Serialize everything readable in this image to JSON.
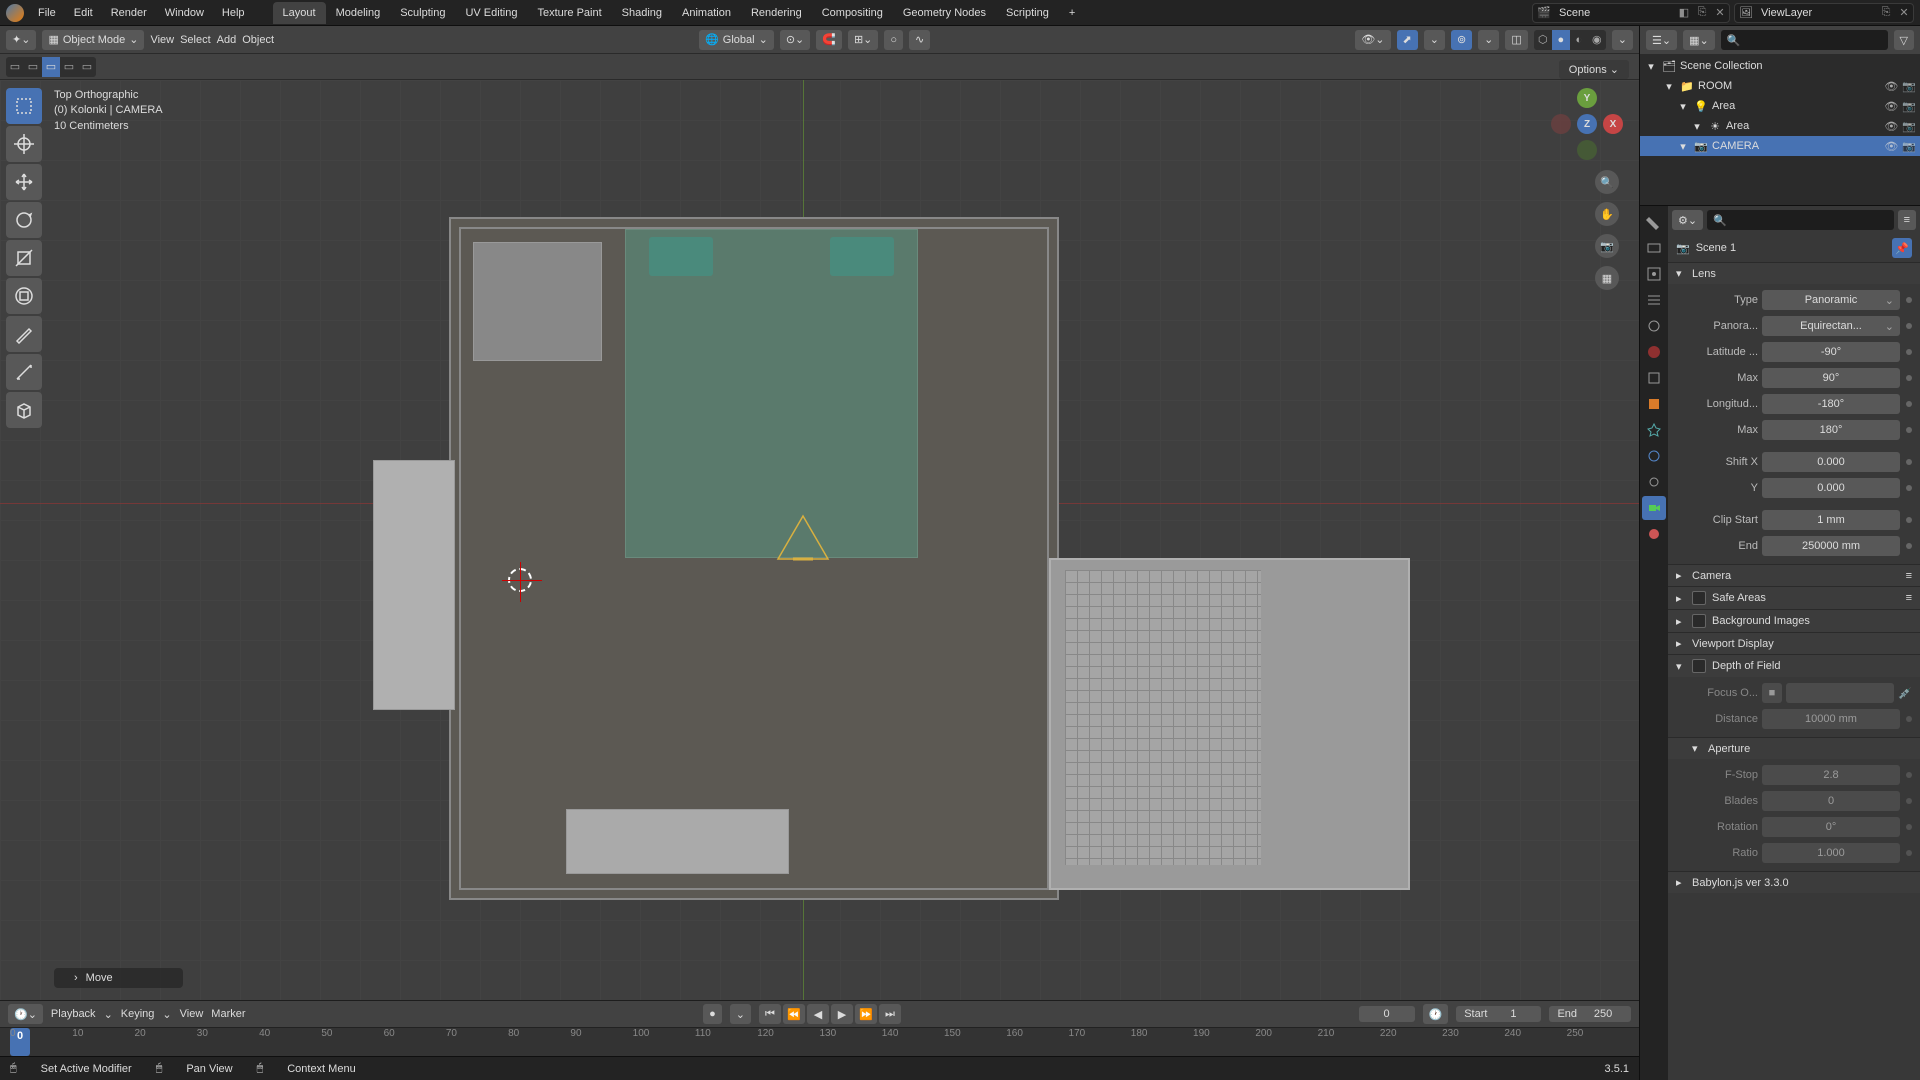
{
  "topbar": {
    "menus": [
      "File",
      "Edit",
      "Render",
      "Window",
      "Help"
    ],
    "workspaces": [
      "Layout",
      "Modeling",
      "Sculpting",
      "UV Editing",
      "Texture Paint",
      "Shading",
      "Animation",
      "Rendering",
      "Compositing",
      "Geometry Nodes",
      "Scripting"
    ],
    "active_workspace": "Layout",
    "scene_label": "Scene",
    "viewlayer_label": "ViewLayer"
  },
  "view3d": {
    "mode": "Object Mode",
    "header_menus": [
      "View",
      "Select",
      "Add",
      "Object"
    ],
    "orientation": "Global",
    "overlay_title": "Top Orthographic",
    "overlay_sub": "(0) Kolonki | CAMERA",
    "overlay_scale": "10 Centimeters",
    "options_label": "Options",
    "last_op": "Move",
    "gizmo_axes": {
      "x": "X",
      "y": "Y",
      "z": "Z"
    }
  },
  "timeline": {
    "menus": [
      "Playback",
      "Keying",
      "View",
      "Marker"
    ],
    "current": "0",
    "start_label": "Start",
    "start": "1",
    "end_label": "End",
    "end": "250",
    "ticks": [
      "0",
      "10",
      "20",
      "30",
      "40",
      "50",
      "60",
      "70",
      "80",
      "90",
      "100",
      "110",
      "120",
      "130",
      "140",
      "150",
      "160",
      "170",
      "180",
      "190",
      "200",
      "210",
      "220",
      "230",
      "240",
      "250"
    ]
  },
  "statusbar": {
    "modifier": "Set Active Modifier",
    "pan": "Pan View",
    "context": "Context Menu",
    "version": "3.5.1"
  },
  "outliner": {
    "root": "Scene Collection",
    "items": [
      {
        "depth": 1,
        "name": "ROOM",
        "type": "collection",
        "sel": false
      },
      {
        "depth": 2,
        "name": "Area",
        "type": "light",
        "sel": false
      },
      {
        "depth": 3,
        "name": "Area",
        "type": "lightdata",
        "sel": false
      },
      {
        "depth": 2,
        "name": "CAMERA",
        "type": "camera",
        "sel": true
      }
    ]
  },
  "props": {
    "breadcrumb": "Scene 1",
    "lens_title": "Lens",
    "rows": {
      "type": {
        "label": "Type",
        "value": "Panoramic"
      },
      "panotype": {
        "label": "Panora...",
        "value": "Equirectan..."
      },
      "latmin": {
        "label": "Latitude ...",
        "value": "-90°"
      },
      "latmax": {
        "label": "Max",
        "value": "90°"
      },
      "lonmin": {
        "label": "Longitud...",
        "value": "-180°"
      },
      "lonmax": {
        "label": "Max",
        "value": "180°"
      },
      "shiftx": {
        "label": "Shift X",
        "value": "0.000"
      },
      "shifty": {
        "label": "Y",
        "value": "0.000"
      },
      "clipstart": {
        "label": "Clip Start",
        "value": "1 mm"
      },
      "clipend": {
        "label": "End",
        "value": "250000 mm"
      }
    },
    "panels": {
      "camera": "Camera",
      "safe": "Safe Areas",
      "bg": "Background Images",
      "viewport": "Viewport Display",
      "dof": "Depth of Field",
      "aperture": "Aperture",
      "babylon": "Babylon.js ver 3.3.0"
    },
    "dof": {
      "focus_label": "Focus O...",
      "distance_label": "Distance",
      "distance": "10000 mm"
    },
    "aperture": {
      "fstop_label": "F-Stop",
      "fstop": "2.8",
      "blades_label": "Blades",
      "blades": "0",
      "rotation_label": "Rotation",
      "rotation": "0°",
      "ratio_label": "Ratio",
      "ratio": "1.000"
    }
  }
}
